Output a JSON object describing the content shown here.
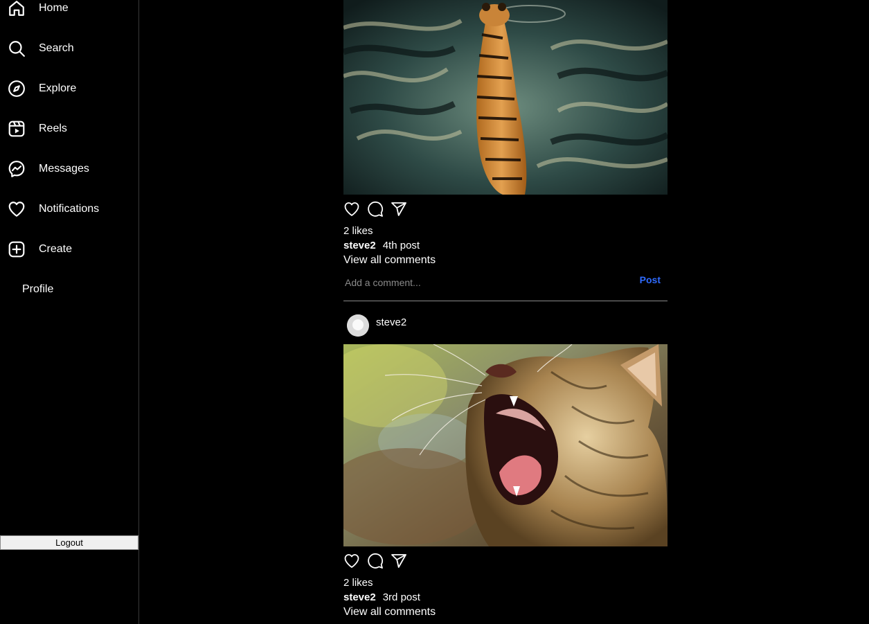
{
  "sidebar": {
    "items": [
      {
        "label": "Home",
        "icon": "home-icon"
      },
      {
        "label": "Search",
        "icon": "search-icon"
      },
      {
        "label": "Explore",
        "icon": "compass-icon"
      },
      {
        "label": "Reels",
        "icon": "reels-icon"
      },
      {
        "label": "Messages",
        "icon": "messenger-icon"
      },
      {
        "label": "Notifications",
        "icon": "heart-icon"
      },
      {
        "label": "Create",
        "icon": "plus-square-icon"
      },
      {
        "label": "Profile",
        "icon": ""
      }
    ],
    "logout_label": "Logout"
  },
  "posts": [
    {
      "username": "steve2",
      "image": "tiger walking through water (photo)",
      "likes": "2 likes",
      "caption": "4th post",
      "view_comments": "View all comments",
      "comment_placeholder": "Add a comment...",
      "post_label": "Post"
    },
    {
      "username": "steve2",
      "image": "yawning tabby cat (photo)",
      "likes": "2 likes",
      "caption": "3rd post",
      "view_comments": "View all comments"
    }
  ],
  "colors": {
    "background": "#000000",
    "text": "#ffffff",
    "accent": "#2f6bff",
    "divider": "#8a8a8a"
  }
}
